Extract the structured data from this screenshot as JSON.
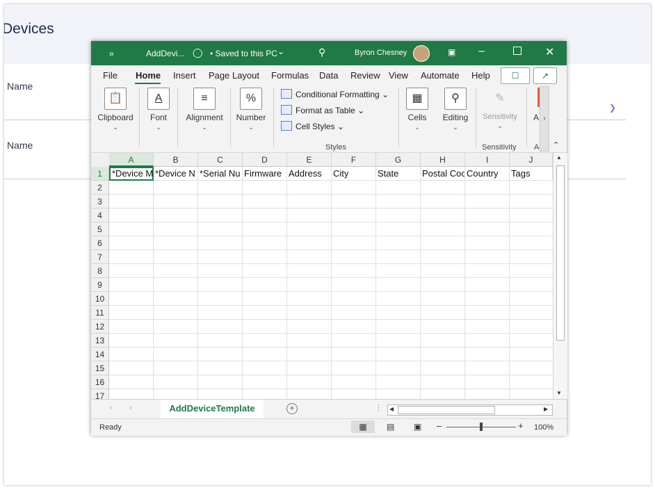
{
  "background": {
    "title": "Devices",
    "field1_label": "Name",
    "field2_label": "Name"
  },
  "excel": {
    "title_more": "»",
    "filename": "AddDevi...",
    "save_status": "• Saved to this PC",
    "user_name": "Byron Chesney",
    "menu": [
      "File",
      "Home",
      "Insert",
      "Page Layout",
      "Formulas",
      "Data",
      "Review",
      "View",
      "Automate",
      "Help"
    ],
    "ribbon": {
      "clipboard": "Clipboard",
      "font": "Font",
      "alignment": "Alignment",
      "number": "Number",
      "conditional_formatting": "Conditional Formatting",
      "format_as_table": "Format as Table",
      "cell_styles": "Cell Styles",
      "styles_caption": "Styles",
      "cells": "Cells",
      "editing": "Editing",
      "sensitivity": "Sensitivity",
      "sensitivity_caption": "Sensitivity",
      "truncated": "A",
      "truncated_caption": "A"
    },
    "columns": [
      "A",
      "B",
      "C",
      "D",
      "E",
      "F",
      "G",
      "H",
      "I",
      "J"
    ],
    "rows": [
      "1",
      "2",
      "3",
      "4",
      "5",
      "6",
      "7",
      "8",
      "9",
      "10",
      "11",
      "12",
      "13",
      "14",
      "15",
      "16",
      "17"
    ],
    "header_cells": [
      "*Device M",
      "*Device N",
      "*Serial Nu",
      "Firmware",
      "Address",
      "City",
      "State",
      "Postal Coc",
      "Country",
      "Tags"
    ],
    "sheet_tab": "AddDeviceTemplate",
    "status_ready": "Ready",
    "zoom": "100%",
    "colors": {
      "accent": "#1f7a45"
    }
  }
}
